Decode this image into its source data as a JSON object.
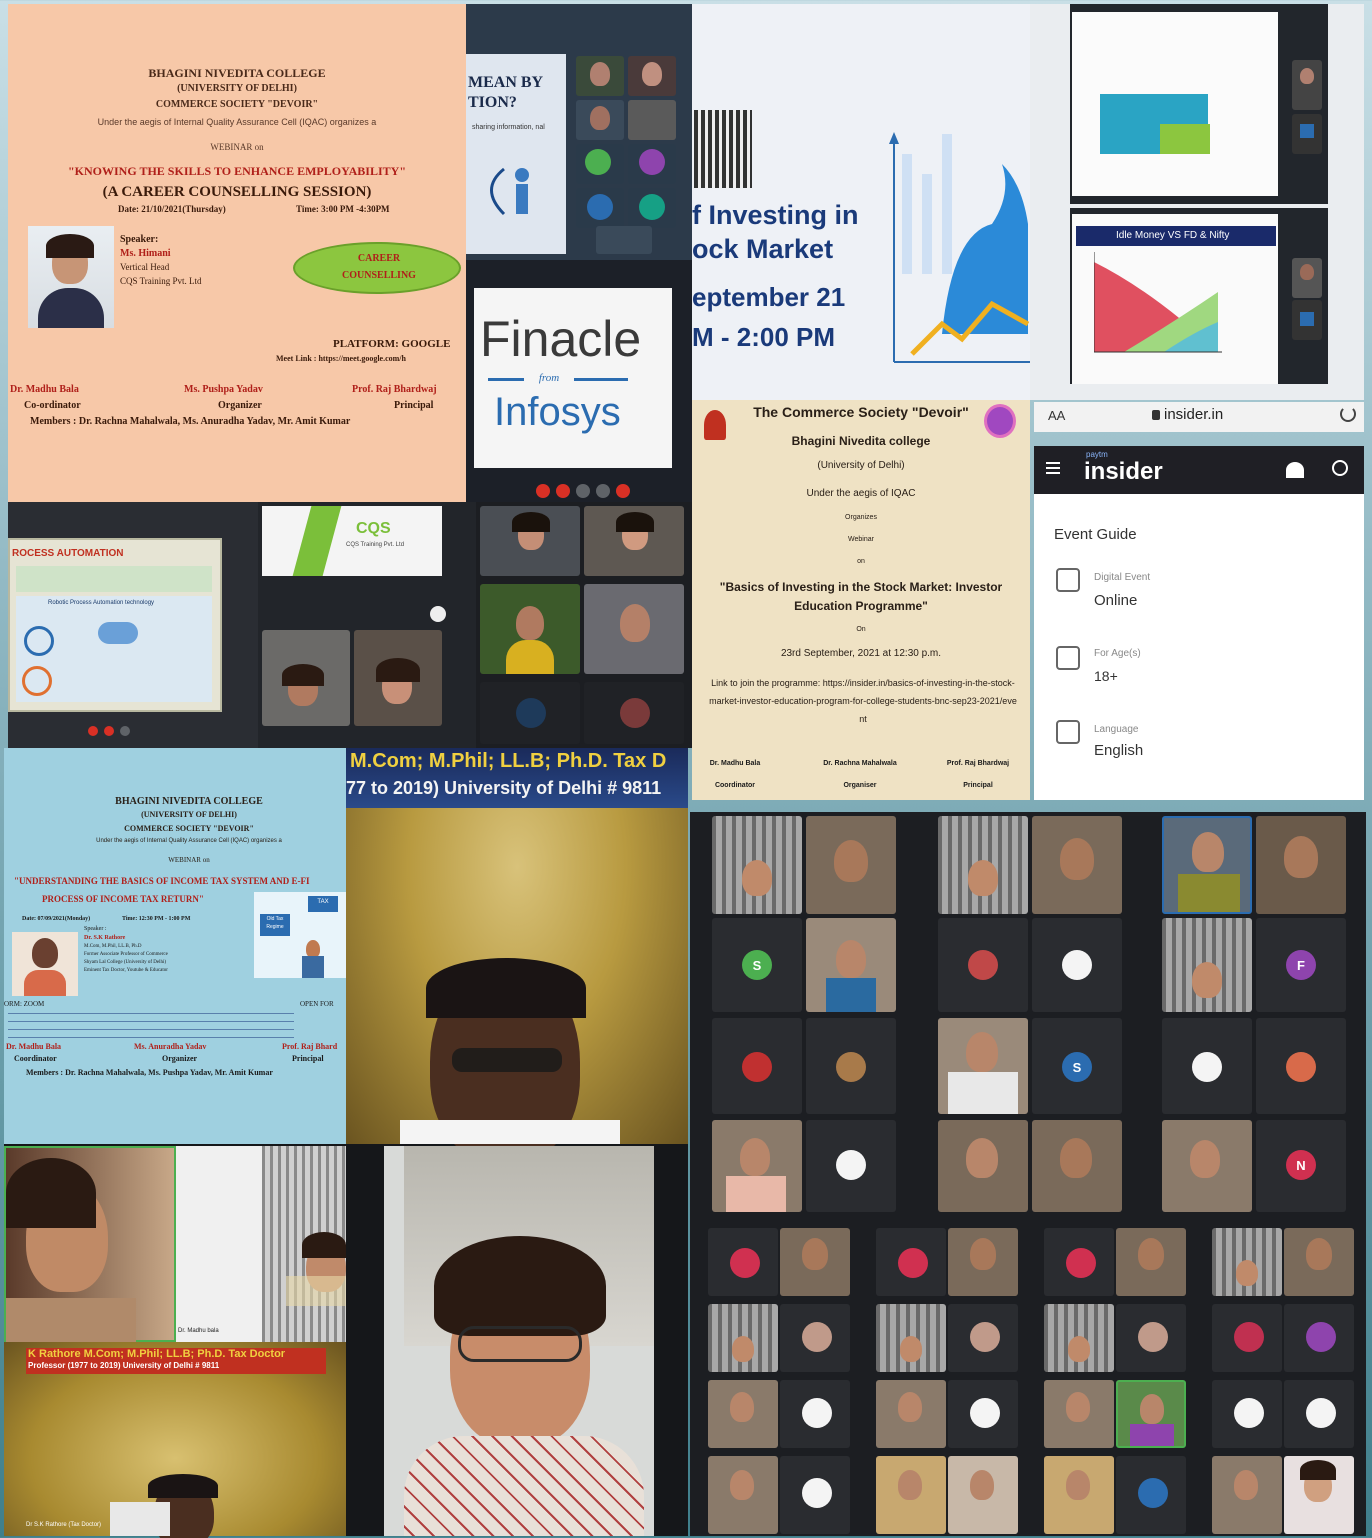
{
  "flyer1": {
    "college": "BHAGINI NIVEDITA COLLEGE",
    "university": "(UNIVERSITY OF DELHI)",
    "society": "COMMERCE SOCIETY \"DEVOIR\"",
    "aegis": "Under the aegis of Internal Quality Assurance Cell (IQAC) organizes a",
    "webinar_on": "WEBINAR on",
    "title": "\"KNOWING THE SKILLS TO ENHANCE EMPLOYABILITY\"",
    "subtitle": "(A CAREER COUNSELLING SESSION)",
    "date": "Date: 21/10/2021(Thursday)",
    "time": "Time: 3:00 PM -4:30PM",
    "speaker_label": "Speaker:",
    "speaker_name": "Ms. Himani",
    "speaker_role": "Vertical Head",
    "speaker_org": "CQS Training Pvt. Ltd",
    "badge_line1": "CAREER",
    "badge_line2": "COUNSELLING",
    "platform": "PLATFORM: GOOGLE",
    "meet_link": "Meet Link : https://meet.google.com/h",
    "people": [
      {
        "name": "Dr. Madhu Bala",
        "role": "Co-ordinator"
      },
      {
        "name": "Ms. Pushpa Yadav",
        "role": "Organizer"
      },
      {
        "name": "Prof. Raj Bhardwaj",
        "role": "Principal"
      }
    ],
    "members": "Members : Dr. Rachna Mahalwala, Ms. Anuradha Yadav, Mr. Amit Kumar"
  },
  "slide1": {
    "heading1": "MEAN BY",
    "heading2": "TION?",
    "body": "sharing information, nal"
  },
  "finacle": {
    "logo": "Finacle",
    "from": "from",
    "infosys": "Infosys"
  },
  "rpa": {
    "heading": "ROCESS AUTOMATION",
    "subtitle": "Robotic Process Automation technology"
  },
  "cqs": {
    "logo": "CQS",
    "text": "CQS Training Pvt. Ltd"
  },
  "investing": {
    "line1": "f Investing in",
    "line2": "ock Market",
    "line3": "eptember 21",
    "line4": "M - 2:00 PM"
  },
  "flyer2": {
    "society": "The Commerce Society \"Devoir\"",
    "college": "Bhagini Nivedita college",
    "university": "(University of Delhi)",
    "aegis": "Under the aegis of IQAC",
    "organizes": "Organizes",
    "webinar": "Webinar",
    "on": "on",
    "title": "\"Basics of Investing in the Stock Market: Investor Education Programme\"",
    "on2": "On",
    "date": "23rd September, 2021 at 12:30 p.m.",
    "link": "Link to join the programme: https://insider.in/basics-of-investing-in-the-stock-market-investor-education-program-for-college-students-bnc-sep23-2021/event",
    "people": [
      {
        "name": "Dr. Madhu Bala",
        "role": "Coordinator"
      },
      {
        "name": "Dr. Rachna Mahalwala",
        "role": "Organiser"
      },
      {
        "name": "Prof. Raj Bhardwaj",
        "role": "Principal"
      }
    ]
  },
  "chart_slide": {
    "title": "Idle Money VS FD & Nifty"
  },
  "mobile": {
    "aa": "AA",
    "url": "insider.in",
    "brand_small": "paytm",
    "brand": "insider",
    "event_guide": "Event Guide",
    "items": [
      {
        "label": "Digital Event",
        "value": "Online"
      },
      {
        "label": "For Age(s)",
        "value": "18+"
      },
      {
        "label": "Language",
        "value": "English"
      }
    ]
  },
  "flyer3": {
    "college": "BHAGINI NIVEDITA COLLEGE",
    "university": "(UNIVERSITY OF DELHI)",
    "society": "COMMERCE SOCIETY \"DEVOIR\"",
    "aegis": "Under the aegis of Internal Quality Assurance Cell (IQAC) organizes a",
    "webinar_on": "WEBINAR on",
    "title1": "\"UNDERSTANDING THE BASICS OF INCOME TAX SYSTEM AND E-FI",
    "title2": "PROCESS OF INCOME TAX RETURN\"",
    "date": "Date: 07/09/2021(Monday)",
    "time": "Time: 12:30 PM - 1:00 PM",
    "speaker_label": "Speaker :",
    "speaker_name": "Dr. S.K Rathore",
    "speaker_detail": "M.Com, M.Phil, LL.B, Ph.D",
    "speaker_detail2": "Former Associate Professor of Commerce",
    "speaker_detail3": "Shyam Lal College (University of Delhi)",
    "speaker_detail4": "Eminent Tax Doctor, Youtube & Educator",
    "platform": "ORM: ZOOM",
    "open_for": "OPEN FOR",
    "badge1": "Old Tax",
    "badge2": "Regime",
    "badge3": "TAX",
    "people": [
      {
        "name": "Dr. Madhu Bala",
        "role": "Coordinator"
      },
      {
        "name": "Ms. Anuradha Yadav",
        "role": "Organizer"
      },
      {
        "name": "Prof. Raj Bhard",
        "role": "Principal"
      }
    ],
    "members": "Members : Dr. Rachna Mahalwala, Ms. Pushpa Yadav, Mr. Amit Kumar"
  },
  "tax_banner": {
    "line1": "M.Com; M.Phil; LL.B; Ph.D. Tax D",
    "line2": "77 to 2019) University of Delhi # 9811"
  },
  "small_banner": {
    "line1": "K Rathore M.Com; M.Phil; LL.B; Ph.D. Tax Doctor",
    "line2": "Professor (1977 to 2019) University of Delhi # 9811"
  },
  "video_names": {
    "madhu": "Dr. Madhu bala",
    "rathore": "Dr S.K Rathore (Tax Doctor)"
  },
  "zoom_initials": {
    "s_green": "S",
    "f_purple": "F",
    "s_blue": "S",
    "n_red": "N"
  },
  "colors": {
    "flyer_peach": "#f7c8a8",
    "flyer_blue": "#9fd0e0",
    "parchment": "#efe2c4",
    "zoom_dark": "#1c1e22",
    "badge_green": "#8cc63f"
  }
}
